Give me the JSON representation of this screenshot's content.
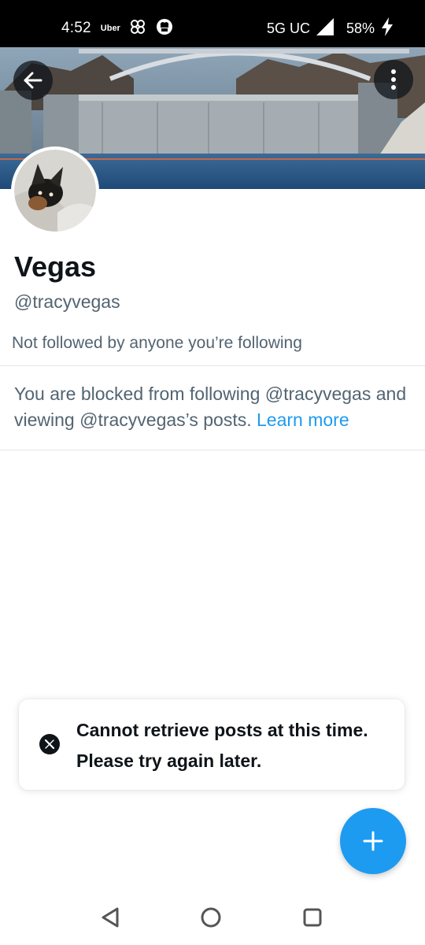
{
  "status_bar": {
    "time": "4:52",
    "uber_label": "Uber",
    "network": "5G UC",
    "battery": "58%"
  },
  "profile": {
    "display_name": "Vegas",
    "handle": "@tracyvegas",
    "followers_note": "Not followed by anyone you’re following",
    "blocked_notice": "You are blocked from following @tracyvegas and viewing @tracyvegas’s posts.",
    "learn_more_label": "Learn more"
  },
  "toast": {
    "message": "Cannot retrieve posts at this time. Please try again later."
  },
  "icons": {
    "back": "arrow-left-icon",
    "more": "more-vertical-icon",
    "compose": "plus-icon",
    "toast": "x-logo-icon",
    "nav_back": "triangle-back-icon",
    "nav_home": "circle-home-icon",
    "nav_recents": "square-recents-icon"
  },
  "colors": {
    "accent": "#1d9bf0",
    "secondary_text": "#536471",
    "primary_text": "#0f1419"
  }
}
